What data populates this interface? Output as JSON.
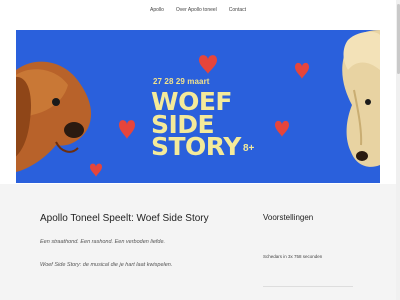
{
  "nav": {
    "items": [
      {
        "label": "Apollo"
      },
      {
        "label": "Over Apollo toneel"
      },
      {
        "label": "Contact"
      }
    ]
  },
  "hero": {
    "dates": "27 28 29 maart",
    "title_line1": "WOEF",
    "title_line2": "SIDE",
    "title_line3": "STORY",
    "age": "8+",
    "background_color": "#2a60dc",
    "text_color": "#f4ea9a",
    "heart_color": "#e6453b"
  },
  "article": {
    "title": "Apollo Toneel Speelt: Woef Side Story",
    "paragraph1": "Een straathond. Een rashond. Een verboden liefde.",
    "paragraph2": "Woef Side Story: de musical die je hart laat kwispelen."
  },
  "sidebar": {
    "title": "Voorstellingen",
    "items": [
      {
        "label": "Schedars in 3x 758 seconden"
      }
    ]
  }
}
